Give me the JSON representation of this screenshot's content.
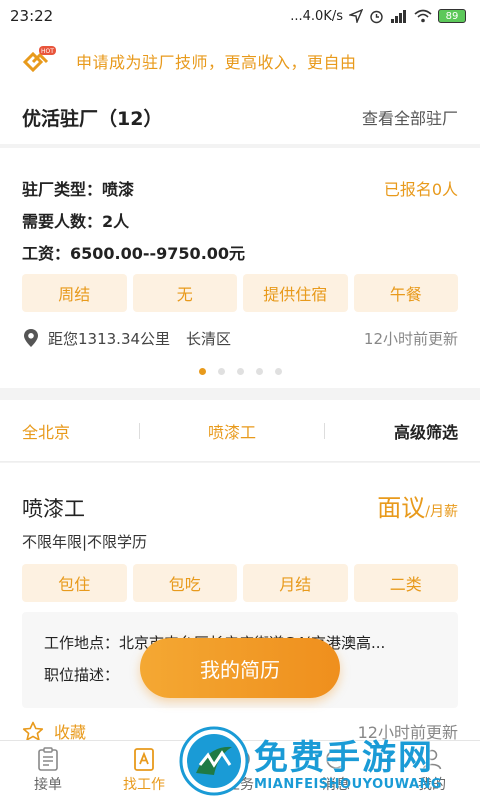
{
  "status": {
    "time": "23:22",
    "network_speed": "...4.0K/s",
    "battery": "89"
  },
  "promo": {
    "text": "申请成为驻厂技师，更高收入，更自由",
    "badge": "HOT"
  },
  "factories": {
    "title": "优活驻厂（12）",
    "view_all": "查看全部驻厂"
  },
  "factory_card": {
    "type_label": "驻厂类型：喷漆",
    "signed_up": "已报名0人",
    "headcount": "需要人数：2人",
    "wage": "工资：6500.00--9750.00元",
    "tags": [
      "周结",
      "无",
      "提供住宿",
      "午餐"
    ],
    "distance": "距您1313.34公里",
    "district": "长清区",
    "updated": "12小时前更新",
    "page_index": 0,
    "page_count": 5
  },
  "filters": {
    "city": "全北京",
    "category": "喷漆工",
    "advanced": "高级筛选"
  },
  "job": {
    "title": "喷漆工",
    "salary": "面议",
    "salary_unit": "/月薪",
    "requirements": "不限年限|不限学历",
    "tags": [
      "包住",
      "包吃",
      "月结",
      "二类"
    ],
    "location": "工作地点：北京市丰台区长辛店街道G4(京港澳高...",
    "description": "职位描述：",
    "favorite": "收藏",
    "updated": "12小时前更新"
  },
  "resume_button": "我的简历",
  "tabs": [
    {
      "label": "接单",
      "icon": "clipboard-icon",
      "active": false
    },
    {
      "label": "找工作",
      "icon": "find-job-icon",
      "active": true
    },
    {
      "label": "任务",
      "icon": "task-icon",
      "active": false
    },
    {
      "label": "消息",
      "icon": "message-icon",
      "active": false
    },
    {
      "label": "我的",
      "icon": "profile-icon",
      "active": false
    }
  ],
  "watermark": {
    "title": "免费手游网",
    "subtitle": "MIANFEISHOUYOUWANG"
  },
  "colors": {
    "accent": "#e89a1c",
    "tag_bg": "#fdf1e1",
    "watermark": "#1a9bd6"
  }
}
